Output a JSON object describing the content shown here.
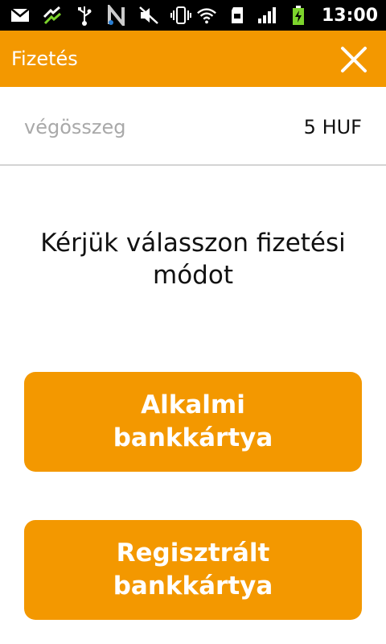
{
  "status_bar": {
    "time": "13:00",
    "icons": [
      "gmail-icon",
      "sync-icon",
      "usb-icon",
      "nfc-icon",
      "mute-icon",
      "vibrate-icon",
      "wifi-icon",
      "sd-card-icon",
      "signal-icon",
      "battery-charging-icon"
    ]
  },
  "app_bar": {
    "title": "Fizetés",
    "close_icon": "close-icon"
  },
  "summary": {
    "label": "végösszeg",
    "value": "5 HUF"
  },
  "prompt": "Kérjük válasszon fizetési módot",
  "buttons": {
    "one_time_card": "Alkalmi\nbankkártya",
    "registered_card": "Regisztrált\nbankkártya"
  },
  "colors": {
    "accent": "#f39800",
    "status_bar": "#000000"
  }
}
